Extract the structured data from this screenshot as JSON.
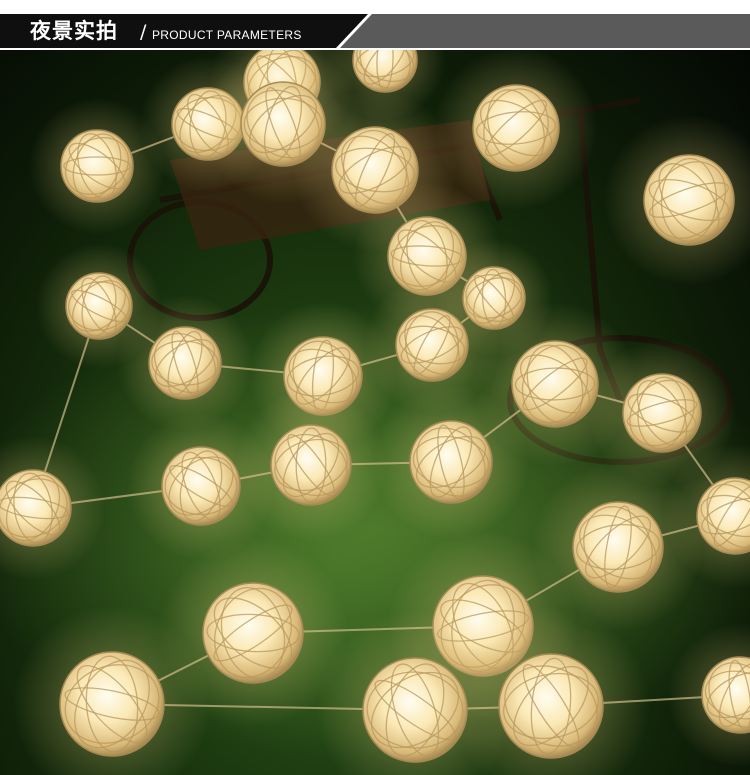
{
  "header": {
    "title_cn": "夜景实拍",
    "separator": "/",
    "title_en": "PRODUCT PARAMETERS"
  },
  "photo": {
    "subject": "rattan-ball-string-lights",
    "colors": {
      "glow": "#fff2c4",
      "core": "#fffbe8",
      "grass": "#2f5a1c",
      "ball_shade": "#d9b978"
    }
  }
}
